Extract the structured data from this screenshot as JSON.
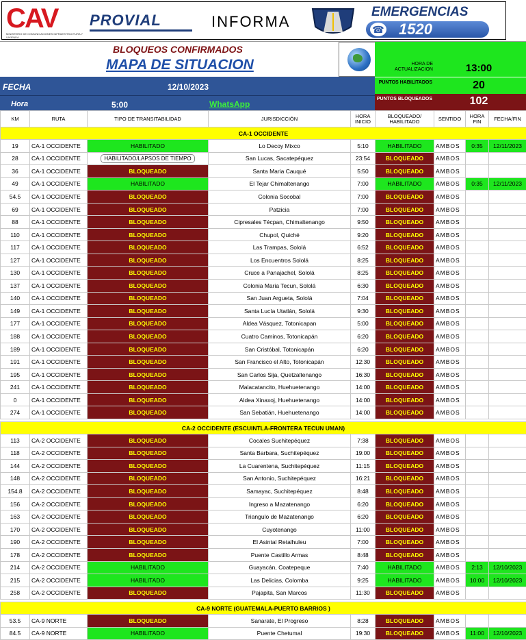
{
  "header": {
    "logo_cav": "CAV",
    "logo_cav_sub": "MINISTERIO DE COMUNICACIONES INFRAESTRUCTURA Y VIVIENDA",
    "provial": "PROVIAL",
    "informa": "INFORMA",
    "emergencias": "EMERGENCIAS",
    "phone": "1520"
  },
  "title": {
    "line1": "BLOQUEOS CONFIRMADOS",
    "line2": "MAPA DE SITUACION"
  },
  "info": {
    "update_label": "HORA DE ACTUALIZACION",
    "update_value": "13:00",
    "fecha_label": "FECHA",
    "fecha_value": "12/10/2023",
    "hora_label": "Hora",
    "hora_value": "5:00",
    "whatsapp": "WhatsApp",
    "habilitados_label": "PUNTOS HABILITADOS",
    "habilitados_value": "20",
    "bloqueados_label": "PUNTOS BLOQUEADOS",
    "bloqueados_value": "102"
  },
  "colors": {
    "bloqueado_bg": "#7b1416",
    "bloqueado_text": "#ffff00",
    "habilitado_bg": "#1ee61e",
    "section_bg": "#ffff00",
    "header_blue": "#2f5597"
  },
  "columns": [
    "KM",
    "RUTA",
    "TIPO DE TRANSITABILIDAD",
    "JURISDICCIÓN",
    "HORA INICIO",
    "BLOQUEADO/ HABILITADO",
    "SENTIDO",
    "HORA FIN",
    "FECHA/FIN"
  ],
  "sections": [
    {
      "title": "CA-1 OCCIDENTE",
      "rows": [
        {
          "km": "19",
          "ruta": "CA-1 OCCIDENTE",
          "tipo": "HABILITADO",
          "jur": "Lo Decoy Mixco",
          "inicio": "5:10",
          "estado": "HABILITADO",
          "sentido": "AMBOS",
          "fin": "0:35",
          "fecha": "12/11/2023"
        },
        {
          "km": "28",
          "ruta": "CA-1 OCCIDENTE",
          "tipo": "HABILITADO/LAPSOS DE TIEMPO",
          "jur": "San Lucas, Sacatepéquez",
          "inicio": "23:54",
          "estado": "BLOQUEADO",
          "sentido": "AMBOS",
          "fin": "",
          "fecha": ""
        },
        {
          "km": "36",
          "ruta": "CA-1 OCCIDENTE",
          "tipo": "BLOQUEADO",
          "jur": "Santa Maria Cauqué",
          "inicio": "5:50",
          "estado": "BLOQUEADO",
          "sentido": "AMBOS",
          "fin": "",
          "fecha": ""
        },
        {
          "km": "49",
          "ruta": "CA-1 OCCIDENTE",
          "tipo": "HABILITADO",
          "jur": "El Tejar Chimaltenango",
          "inicio": "7:00",
          "estado": "HABILITADO",
          "sentido": "AMBOS",
          "fin": "0:35",
          "fecha": "12/11/2023"
        },
        {
          "km": "54.5",
          "ruta": "CA-1 OCCIDENTE",
          "tipo": "BLOQUEADO",
          "jur": "Colonia Socobal",
          "inicio": "7:00",
          "estado": "BLOQUEADO",
          "sentido": "AMBOS",
          "fin": "",
          "fecha": ""
        },
        {
          "km": "69",
          "ruta": "CA-1 OCCIDENTE",
          "tipo": "BLOQUEADO",
          "jur": "Patzicia",
          "inicio": "7:00",
          "estado": "BLOQUEADO",
          "sentido": "AMBOS",
          "fin": "",
          "fecha": ""
        },
        {
          "km": "88",
          "ruta": "CA-1 OCCIDENTE",
          "tipo": "BLOQUEADO",
          "jur": "Cipresales Técpan, Chimaltenango",
          "inicio": "9:50",
          "estado": "BLOQUEADO",
          "sentido": "AMBOS",
          "fin": "",
          "fecha": ""
        },
        {
          "km": "110",
          "ruta": "CA-1 OCCIDENTE",
          "tipo": "BLOQUEADO",
          "jur": "Chupol, Quiché",
          "inicio": "9:20",
          "estado": "BLOQUEADO",
          "sentido": "AMBOS",
          "fin": "",
          "fecha": ""
        },
        {
          "km": "117",
          "ruta": "CA-1 OCCIDENTE",
          "tipo": "BLOQUEADO",
          "jur": "Las Trampas, Sololá",
          "inicio": "6:52",
          "estado": "BLOQUEADO",
          "sentido": "AMBOS",
          "fin": "",
          "fecha": ""
        },
        {
          "km": "127",
          "ruta": "CA-1 OCCIDENTE",
          "tipo": "BLOQUEADO",
          "jur": "Los Encuentros Sololá",
          "inicio": "8:25",
          "estado": "BLOQUEADO",
          "sentido": "AMBOS",
          "fin": "",
          "fecha": ""
        },
        {
          "km": "130",
          "ruta": "CA-1 OCCIDENTE",
          "tipo": "BLOQUEADO",
          "jur": "Cruce a Panajachel, Sololá",
          "inicio": "8:25",
          "estado": "BLOQUEADO",
          "sentido": "AMBOS",
          "fin": "",
          "fecha": ""
        },
        {
          "km": "137",
          "ruta": "CA-1 OCCIDENTE",
          "tipo": "BLOQUEADO",
          "jur": "Colonia Maria Tecun, Sololá",
          "inicio": "6:30",
          "estado": "BLOQUEADO",
          "sentido": "AMBOS",
          "fin": "",
          "fecha": ""
        },
        {
          "km": "140",
          "ruta": "CA-1 OCCIDENTE",
          "tipo": "BLOQUEADO",
          "jur": "San Juan Argueta, Sololá",
          "inicio": "7:04",
          "estado": "BLOQUEADO",
          "sentido": "AMBOS",
          "fin": "",
          "fecha": ""
        },
        {
          "km": "149",
          "ruta": "CA-1 OCCIDENTE",
          "tipo": "BLOQUEADO",
          "jur": "Santa Lucía Utatlán, Sololá",
          "inicio": "9:30",
          "estado": "BLOQUEADO",
          "sentido": "AMBOS",
          "fin": "",
          "fecha": ""
        },
        {
          "km": "177",
          "ruta": "CA-1 OCCIDENTE",
          "tipo": "BLOQUEADO",
          "jur": "Aldea Vásquez, Totonicapan",
          "inicio": "5:00",
          "estado": "BLOQUEADO",
          "sentido": "AMBOS",
          "fin": "",
          "fecha": ""
        },
        {
          "km": "188",
          "ruta": "CA-1 OCCIDENTE",
          "tipo": "BLOQUEADO",
          "jur": "Cuatro Caminos, Totonicapán",
          "inicio": "6:20",
          "estado": "BLOQUEADO",
          "sentido": "AMBOS",
          "fin": "",
          "fecha": ""
        },
        {
          "km": "189",
          "ruta": "CA-1 OCCIDENTE",
          "tipo": "BLOQUEADO",
          "jur": "San Cristóbal, Totonicapán",
          "inicio": "6:20",
          "estado": "BLOQUEADO",
          "sentido": "AMBOS",
          "fin": "",
          "fecha": ""
        },
        {
          "km": "191",
          "ruta": "CA-1 OCCIDENTE",
          "tipo": "BLOQUEADO",
          "jur": "San Francisco el Alto, Totonicapán",
          "inicio": "12:30",
          "estado": "BLOQUEADO",
          "sentido": "AMBOS",
          "fin": "",
          "fecha": ""
        },
        {
          "km": "195",
          "ruta": "CA-1 OCCIDENTE",
          "tipo": "BLOQUEADO",
          "jur": "San Carlos Sija, Quetzaltenango",
          "inicio": "16:30",
          "estado": "BLOQUEADO",
          "sentido": "AMBOS",
          "fin": "",
          "fecha": ""
        },
        {
          "km": "241",
          "ruta": "CA-1 OCCIDENTE",
          "tipo": "BLOQUEADO",
          "jur": "Malacatancito, Huehuetenango",
          "inicio": "14:00",
          "estado": "BLOQUEADO",
          "sentido": "AMBOS",
          "fin": "",
          "fecha": ""
        },
        {
          "km": "0",
          "ruta": "CA-1 OCCIDENTE",
          "tipo": "BLOQUEADO",
          "jur": "Aldea Xinaxoj, Huehuetenango",
          "inicio": "14:00",
          "estado": "BLOQUEADO",
          "sentido": "AMBOS",
          "fin": "",
          "fecha": ""
        },
        {
          "km": "274",
          "ruta": "CA-1 OCCIDENTE",
          "tipo": "BLOQUEADO",
          "jur": "San Sebatián, Huehuetenango",
          "inicio": "14:00",
          "estado": "BLOQUEADO",
          "sentido": "AMBOS",
          "fin": "",
          "fecha": ""
        }
      ]
    },
    {
      "title": "CA-2 OCCIDENTE (ESCUINTLA-FRONTERA TECUN UMAN)",
      "rows": [
        {
          "km": "113",
          "ruta": "CA-2 OCCIDENTE",
          "tipo": "BLOQUEADO",
          "jur": "Cocales Suchitepéquez",
          "inicio": "7:38",
          "estado": "BLOQUEADO",
          "sentido": "AMBOS",
          "fin": "",
          "fecha": ""
        },
        {
          "km": "118",
          "ruta": "CA-2 OCCIDENTE",
          "tipo": "BLOQUEADO",
          "jur": "Santa Barbara, Suchitepéquez",
          "inicio": "19:00",
          "estado": "BLOQUEADO",
          "sentido": "AMBOS",
          "fin": "",
          "fecha": ""
        },
        {
          "km": "144",
          "ruta": "CA-2 OCCIDENTE",
          "tipo": "BLOQUEADO",
          "jur": "La Cuarentena, Suchitepéquez",
          "inicio": "11:15",
          "estado": "BLOQUEADO",
          "sentido": "AMBOS",
          "fin": "",
          "fecha": ""
        },
        {
          "km": "148",
          "ruta": "CA-2 OCCIDENTE",
          "tipo": "BLOQUEADO",
          "jur": "San Antonio, Suchitepéquez",
          "inicio": "16:21",
          "estado": "BLOQUEADO",
          "sentido": "AMBOS",
          "fin": "",
          "fecha": ""
        },
        {
          "km": "154.8",
          "ruta": "CA-2 OCCIDENTE",
          "tipo": "BLOQUEADO",
          "jur": "Samayac, Suchitepéquez",
          "inicio": "8:48",
          "estado": "BLOQUEADO",
          "sentido": "AMBOS",
          "fin": "",
          "fecha": ""
        },
        {
          "km": "156",
          "ruta": "CA-2 OCCIDENTE",
          "tipo": "BLOQUEADO",
          "jur": "Ingreso a Mazatenango",
          "inicio": "6:20",
          "estado": "BLOQUEADO",
          "sentido": "AMBOS",
          "fin": "",
          "fecha": ""
        },
        {
          "km": "163",
          "ruta": "CA-2 OCCIDENTE",
          "tipo": "BLOQUEADO",
          "jur": "Triangulo de Mazatenango",
          "inicio": "6:20",
          "estado": "BLOQUEADO",
          "sentido": "AMBOS",
          "fin": "",
          "fecha": ""
        },
        {
          "km": "170",
          "ruta": "CA-2 OCCIDENTE",
          "tipo": "BLOQUEADO",
          "jur": "Cuyotenango",
          "inicio": "11:00",
          "estado": "BLOQUEADO",
          "sentido": "AMBOS",
          "fin": "",
          "fecha": ""
        },
        {
          "km": "190",
          "ruta": "CA-2 OCCIDENTE",
          "tipo": "BLOQUEADO",
          "jur": "El Asintal Retalhuleu",
          "inicio": "7:00",
          "estado": "BLOQUEADO",
          "sentido": "AMBOS",
          "fin": "",
          "fecha": ""
        },
        {
          "km": "178",
          "ruta": "CA-2 OCCIDENTE",
          "tipo": "BLOQUEADO",
          "jur": "Puente Castillo Armas",
          "inicio": "8:48",
          "estado": "BLOQUEADO",
          "sentido": "AMBOS",
          "fin": "",
          "fecha": ""
        },
        {
          "km": "214",
          "ruta": "CA-2 OCCIDENTE",
          "tipo": "HABILITADO",
          "jur": "Guayacán, Coatepeque",
          "inicio": "7:40",
          "estado": "HABILITADO",
          "sentido": "AMBOS",
          "fin": "2:13",
          "fecha": "12/10/2023"
        },
        {
          "km": "215",
          "ruta": "CA-2 OCCIDENTE",
          "tipo": "HABILITADO",
          "jur": "Las Delicias, Colomba",
          "inicio": "9:25",
          "estado": "HABILITADO",
          "sentido": "AMBOS",
          "fin": "10:00",
          "fecha": "12/10/2023"
        },
        {
          "km": "258",
          "ruta": "CA-2 OCCIDENTE",
          "tipo": "BLOQUEADO",
          "jur": "Pajapita, San Marcos",
          "inicio": "11:30",
          "estado": "BLOQUEADO",
          "sentido": "AMBOS",
          "fin": "",
          "fecha": ""
        }
      ]
    },
    {
      "title": "CA-9 NORTE (GUATEMALA-PUERTO BARRIOS )",
      "rows": [
        {
          "km": "53.5",
          "ruta": "CA-9 NORTE",
          "tipo": "BLOQUEADO",
          "jur": "Sanarate, El Progreso",
          "inicio": "8:28",
          "estado": "BLOQUEADO",
          "sentido": "AMBOS",
          "fin": "",
          "fecha": ""
        },
        {
          "km": "84.5",
          "ruta": "CA-9 NORTE",
          "tipo": "HABILITADO",
          "jur": "Puente Chetumal",
          "inicio": "19:30",
          "estado": "BLOQUEADO",
          "sentido": "AMBOS",
          "fin": "11:00",
          "fecha": "12/10/2023"
        }
      ]
    }
  ]
}
